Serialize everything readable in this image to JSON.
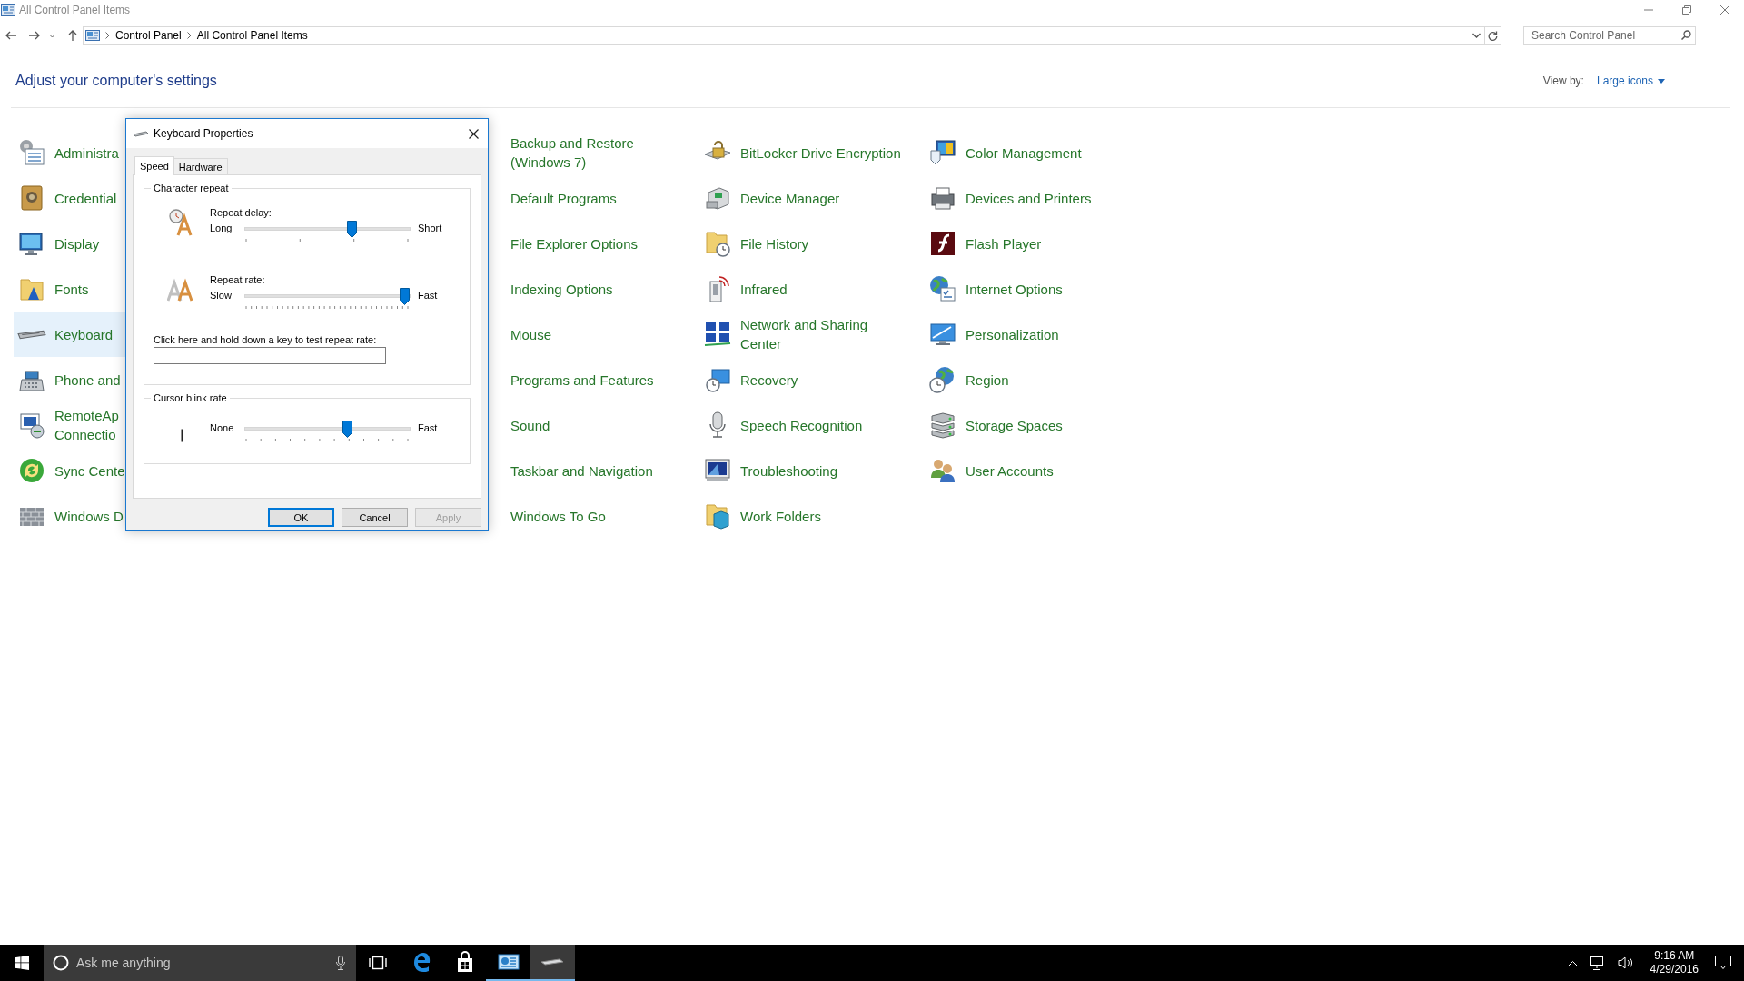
{
  "window": {
    "title": "All Control Panel Items"
  },
  "address": {
    "breadcrumbs": [
      "Control Panel",
      "All Control Panel Items"
    ],
    "search": {
      "placeholder": "Search Control Panel"
    }
  },
  "heading": "Adjust your computer's settings",
  "view_by": {
    "label": "View by:",
    "value": "Large icons"
  },
  "items": [
    {
      "label": "Administra",
      "selected": false
    },
    {
      "label": "Backup and Restore\n(Windows 7)",
      "selected": false
    },
    {
      "label": "BitLocker Drive Encryption",
      "selected": false
    },
    {
      "label": "Color Management",
      "selected": false
    },
    {
      "label": "Credential",
      "selected": false
    },
    {
      "label": "Default Programs",
      "selected": false
    },
    {
      "label": "Device Manager",
      "selected": false
    },
    {
      "label": "Devices and Printers",
      "selected": false
    },
    {
      "label": "Display",
      "selected": false
    },
    {
      "label": "File Explorer Options",
      "selected": false
    },
    {
      "label": "File History",
      "selected": false
    },
    {
      "label": "Flash Player",
      "selected": false
    },
    {
      "label": "Fonts",
      "selected": false
    },
    {
      "label": "Indexing Options",
      "selected": false
    },
    {
      "label": "Infrared",
      "selected": false
    },
    {
      "label": "Internet Options",
      "selected": false
    },
    {
      "label": "Keyboard",
      "selected": true
    },
    {
      "label": "Mouse",
      "selected": false
    },
    {
      "label": "Network and Sharing\nCenter",
      "selected": false
    },
    {
      "label": "Personalization",
      "selected": false
    },
    {
      "label": "Phone and",
      "selected": false
    },
    {
      "label": "Programs and Features",
      "selected": false
    },
    {
      "label": "Recovery",
      "selected": false
    },
    {
      "label": "Region",
      "selected": false
    },
    {
      "label": "RemoteAp\nConnectio",
      "selected": false
    },
    {
      "label": "Sound",
      "selected": false
    },
    {
      "label": "Speech Recognition",
      "selected": false
    },
    {
      "label": "Storage Spaces",
      "selected": false
    },
    {
      "label": "Sync Cente",
      "selected": false
    },
    {
      "label": "Taskbar and Navigation",
      "selected": false
    },
    {
      "label": "Troubleshooting",
      "selected": false
    },
    {
      "label": "User Accounts",
      "selected": false
    },
    {
      "label": "Windows D",
      "selected": false
    },
    {
      "label": "Windows To Go",
      "selected": false
    },
    {
      "label": "Work Folders",
      "selected": false
    }
  ],
  "dialog": {
    "title": "Keyboard Properties",
    "tabs": [
      {
        "label": "Speed",
        "selected": true
      },
      {
        "label": "Hardware",
        "selected": false
      }
    ],
    "character_repeat": {
      "title": "Character repeat",
      "sliders": [
        {
          "kind": "delay",
          "label": "Repeat delay:",
          "min_label": "Long",
          "max_label": "Short",
          "level": 0.667
        },
        {
          "kind": "rate",
          "label": "Repeat rate:",
          "min_label": "Slow",
          "max_label": "Fast",
          "level": 1.0
        }
      ],
      "test_label": "Click here and hold down a key to test repeat rate:"
    },
    "cursor_blink": {
      "title": "Cursor blink rate",
      "slider": {
        "kind": "blink",
        "min_label": "None",
        "max_label": "Fast",
        "level": 0.636
      }
    },
    "buttons": [
      {
        "label": "OK",
        "default": true,
        "disabled": false
      },
      {
        "label": "Cancel",
        "default": false,
        "disabled": false
      },
      {
        "label": "Apply",
        "default": false,
        "disabled": true
      }
    ]
  },
  "taskbar": {
    "search": {
      "placeholder": "Ask me anything"
    },
    "apps": [
      {
        "kind": "edge",
        "open": false,
        "active": false
      },
      {
        "kind": "store",
        "open": false,
        "active": false
      },
      {
        "kind": "control_panel",
        "open": true,
        "active": false
      },
      {
        "kind": "keyboard",
        "open": true,
        "active": true
      }
    ],
    "clock": {
      "time": "9:16 AM",
      "date": "4/29/2016"
    }
  }
}
